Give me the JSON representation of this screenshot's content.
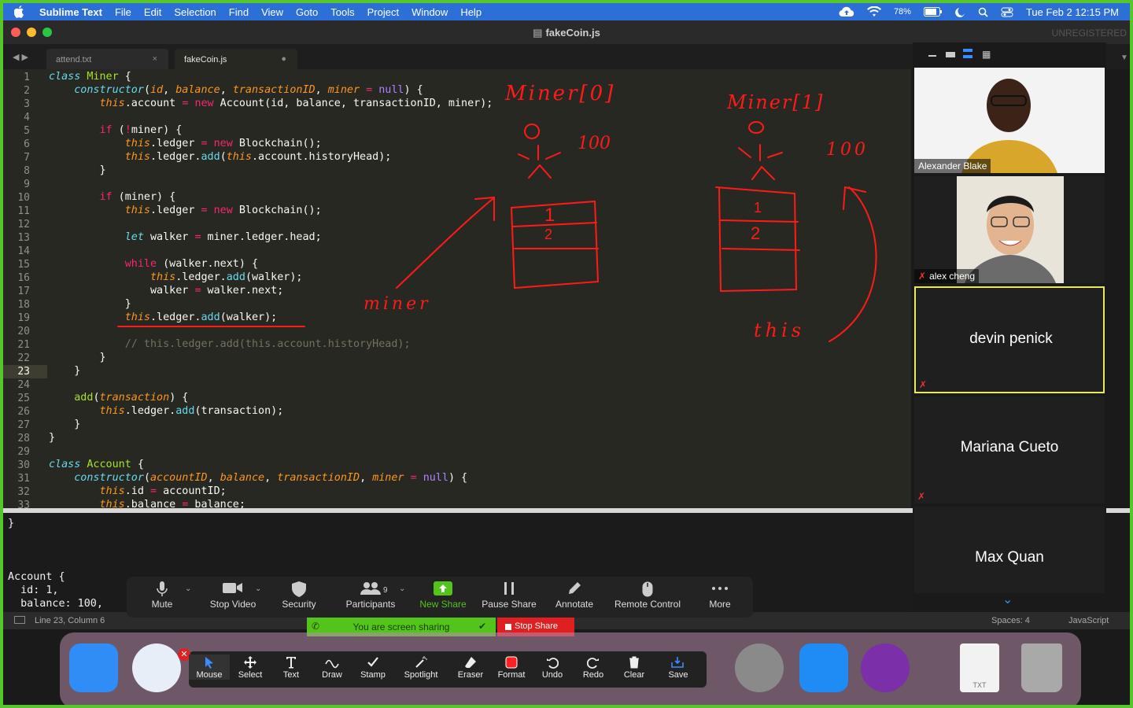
{
  "menubar": {
    "app_name": "Sublime Text",
    "menus": [
      "File",
      "Edit",
      "Selection",
      "Find",
      "View",
      "Goto",
      "Tools",
      "Project",
      "Window",
      "Help"
    ],
    "battery": "78%",
    "datetime": "Tue Feb 2  12:15 PM"
  },
  "window": {
    "title": "fakeCoin.js",
    "unregistered": "UNREGISTERED"
  },
  "tabs": [
    {
      "label": "attend.txt",
      "close": "×"
    },
    {
      "label": "fakeCoin.js",
      "close": "●"
    }
  ],
  "editor": {
    "line_numbers": [
      "1",
      "2",
      "3",
      "4",
      "5",
      "6",
      "7",
      "8",
      "9",
      "10",
      "11",
      "12",
      "13",
      "14",
      "15",
      "16",
      "17",
      "18",
      "19",
      "20",
      "21",
      "22",
      "23",
      "24",
      "25",
      "26",
      "27",
      "28",
      "29",
      "30",
      "31",
      "32",
      "33"
    ]
  },
  "annotations": {
    "miner0": "Miner[0]",
    "miner1": "Miner[1]",
    "val0": "100",
    "val1": "100",
    "row1": "1",
    "row2": "2",
    "row1b": "1",
    "row2b": "2",
    "miner_label": "miner",
    "this_label": "this"
  },
  "output": {
    "lines": [
      "}",
      "Account {",
      "  id: 1,",
      "  balance: 100,"
    ]
  },
  "statusbar": {
    "position": "Line 23, Column 6",
    "spaces": "Spaces: 4",
    "syntax": "JavaScript"
  },
  "zoom_toolbar": {
    "items": [
      "Mute",
      "Stop Video",
      "Security",
      "Participants",
      "New Share",
      "Pause Share",
      "Annotate",
      "Remote Control",
      "More"
    ],
    "participants_count": "9"
  },
  "share_banner": {
    "message": "You are screen sharing",
    "stop_label": "Stop Share"
  },
  "participants": [
    {
      "name": "Alexander Blake"
    },
    {
      "name": "alex cheng"
    },
    {
      "name": "devin penick"
    },
    {
      "name": "Mariana Cueto"
    },
    {
      "name": "Max Quan"
    }
  ],
  "annotate_toolbar": {
    "items": [
      "Mouse",
      "Select",
      "Text",
      "Draw",
      "Stamp",
      "Spotlight",
      "Eraser",
      "Format",
      "Undo",
      "Redo",
      "Clear",
      "Save"
    ]
  },
  "dock": {
    "txt_label": "TXT"
  },
  "colors": {
    "menubar": "#2c6fd6",
    "share_green": "#52c41a",
    "stop_red": "#e02020",
    "ink_red": "#ff1a1a",
    "speaker_yellow": "#e8e85a"
  }
}
